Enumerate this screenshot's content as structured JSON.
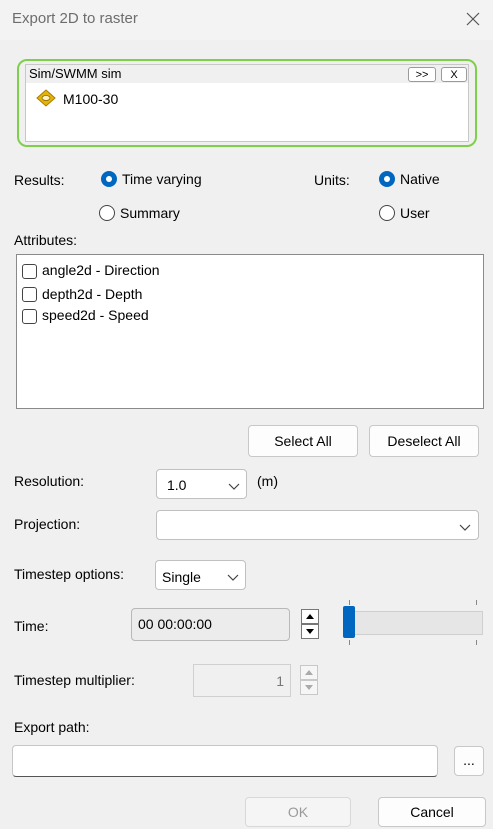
{
  "window": {
    "title": "Export 2D to raster"
  },
  "sim": {
    "label": "Sim/SWMM sim",
    "expand_label": ">>",
    "clear_label": "X",
    "item": "M100-30"
  },
  "results": {
    "label": "Results:",
    "options": [
      "Time varying",
      "Summary"
    ],
    "selected": "Time varying"
  },
  "units": {
    "label": "Units:",
    "options": [
      "Native",
      "User"
    ],
    "selected": "Native"
  },
  "attributes": {
    "label": "Attributes:",
    "items": [
      "angle2d - Direction",
      "depth2d - Depth",
      "speed2d - Speed"
    ]
  },
  "buttons": {
    "select_all": "Select All",
    "deselect_all": "Deselect All",
    "ok": "OK",
    "cancel": "Cancel",
    "browse": "..."
  },
  "resolution": {
    "label": "Resolution:",
    "value": "1.0",
    "unit": "(m)"
  },
  "projection": {
    "label": "Projection:",
    "value": ""
  },
  "timestep_options": {
    "label": "Timestep options:",
    "value": "Single"
  },
  "time": {
    "label": "Time:",
    "value": "00 00:00:00",
    "slider_position": 0
  },
  "timestep_multiplier": {
    "label": "Timestep multiplier:",
    "value": "1"
  },
  "export_path": {
    "label": "Export path:",
    "value": ""
  }
}
